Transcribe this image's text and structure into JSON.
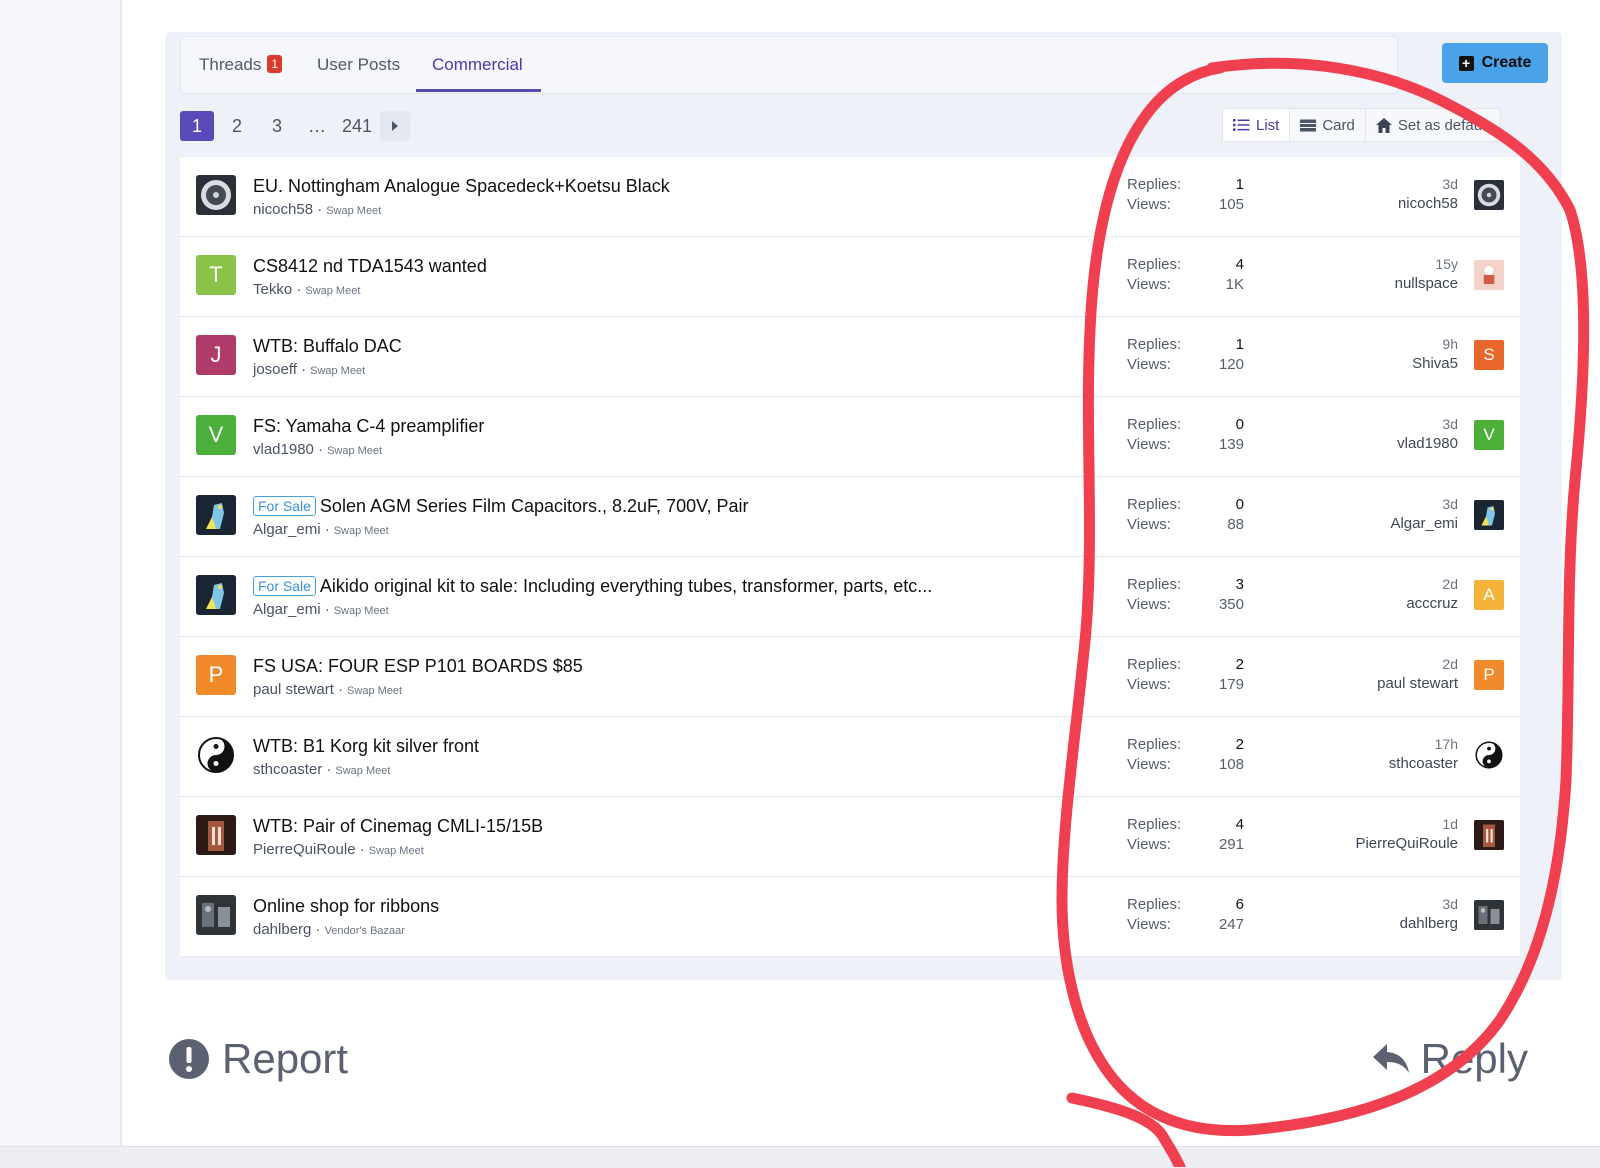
{
  "tabs": [
    {
      "label": "Threads",
      "badge": "1"
    },
    {
      "label": "User Posts"
    },
    {
      "label": "Commercial"
    }
  ],
  "create_label": "Create",
  "pagination": {
    "pages": [
      "1",
      "2",
      "3",
      "…",
      "241"
    ],
    "current": "1"
  },
  "view_switch": {
    "list": "List",
    "card": "Card",
    "default": "Set as default"
  },
  "stat_labels": {
    "replies": "Replies:",
    "views": "Views:"
  },
  "threads": [
    {
      "avatar": {
        "type": "image",
        "name": "turntable-photo",
        "color": "#2b3038"
      },
      "tag": "",
      "title": "EU. Nottingham Analogue Spacedeck+Koetsu Black",
      "author": "nicoch58",
      "forum": "Swap Meet",
      "replies": "1",
      "views": "105",
      "last_time": "3d",
      "last_user": "nicoch58",
      "last_avatar": {
        "type": "image",
        "name": "turntable-photo",
        "color": "#2b3038"
      }
    },
    {
      "avatar": {
        "type": "letter",
        "letter": "T",
        "color": "#8bc34a"
      },
      "tag": "",
      "title": "CS8412 nd TDA1543 wanted",
      "author": "Tekko",
      "forum": "Swap Meet",
      "replies": "4",
      "views": "1K",
      "last_time": "15y",
      "last_user": "nullspace",
      "last_avatar": {
        "type": "image",
        "name": "cartoon-photo",
        "color": "#e7a89a"
      }
    },
    {
      "avatar": {
        "type": "letter",
        "letter": "J",
        "color": "#b03a6a"
      },
      "tag": "",
      "title": "WTB: Buffalo DAC",
      "author": "josoeff",
      "forum": "Swap Meet",
      "replies": "1",
      "views": "120",
      "last_time": "9h",
      "last_user": "Shiva5",
      "last_avatar": {
        "type": "letter",
        "letter": "S",
        "color": "#e9672a"
      }
    },
    {
      "avatar": {
        "type": "letter",
        "letter": "V",
        "color": "#4caf3a"
      },
      "tag": "",
      "title": "FS: Yamaha C-4 preamplifier",
      "author": "vlad1980",
      "forum": "Swap Meet",
      "replies": "0",
      "views": "139",
      "last_time": "3d",
      "last_user": "vlad1980",
      "last_avatar": {
        "type": "letter",
        "letter": "V",
        "color": "#4caf3a"
      }
    },
    {
      "avatar": {
        "type": "image",
        "name": "parrot-photo",
        "color": "#3f6f8f"
      },
      "tag": "For Sale",
      "title": "Solen AGM Series Film Capacitors., 8.2uF, 700V, Pair",
      "author": "Algar_emi",
      "forum": "Swap Meet",
      "replies": "0",
      "views": "88",
      "last_time": "3d",
      "last_user": "Algar_emi",
      "last_avatar": {
        "type": "image",
        "name": "parrot-photo",
        "color": "#3f6f8f"
      }
    },
    {
      "avatar": {
        "type": "image",
        "name": "parrot-photo",
        "color": "#3f6f8f"
      },
      "tag": "For Sale",
      "title": "Aikido original kit to sale: Including everything tubes, transformer, parts, etc...",
      "author": "Algar_emi",
      "forum": "Swap Meet",
      "replies": "3",
      "views": "350",
      "last_time": "2d",
      "last_user": "acccruz",
      "last_avatar": {
        "type": "letter",
        "letter": "A",
        "color": "#f4b43a"
      }
    },
    {
      "avatar": {
        "type": "letter",
        "letter": "P",
        "color": "#f08a2a"
      },
      "tag": "",
      "title": "FS USA: FOUR ESP P101 BOARDS $85",
      "author": "paul stewart",
      "forum": "Swap Meet",
      "replies": "2",
      "views": "179",
      "last_time": "2d",
      "last_user": "paul stewart",
      "last_avatar": {
        "type": "letter",
        "letter": "P",
        "color": "#f08a2a"
      }
    },
    {
      "avatar": {
        "type": "image",
        "name": "yin-yang-logo",
        "color": "#ffffff"
      },
      "tag": "",
      "title": "WTB: B1 Korg kit silver front",
      "author": "sthcoaster",
      "forum": "Swap Meet",
      "replies": "2",
      "views": "108",
      "last_time": "17h",
      "last_user": "sthcoaster",
      "last_avatar": {
        "type": "image",
        "name": "yin-yang-logo",
        "color": "#ffffff"
      }
    },
    {
      "avatar": {
        "type": "image",
        "name": "building-photo",
        "color": "#4a2a22"
      },
      "tag": "",
      "title": "WTB: Pair of Cinemag CMLI-15/15B",
      "author": "PierreQuiRoule",
      "forum": "Swap Meet",
      "replies": "4",
      "views": "291",
      "last_time": "1d",
      "last_user": "PierreQuiRoule",
      "last_avatar": {
        "type": "image",
        "name": "building-photo",
        "color": "#4a2a22"
      }
    },
    {
      "avatar": {
        "type": "image",
        "name": "equipment-photo",
        "color": "#3d4148"
      },
      "tag": "",
      "title": "Online shop for ribbons",
      "author": "dahlberg",
      "forum": "Vendor's Bazaar",
      "replies": "6",
      "views": "247",
      "last_time": "3d",
      "last_user": "dahlberg",
      "last_avatar": {
        "type": "image",
        "name": "equipment-photo",
        "color": "#3d4148"
      }
    }
  ],
  "footer": {
    "report_label": "Report",
    "reply_label": "Reply"
  },
  "colors": {
    "accent": "#5a49b8",
    "create_button": "#4aa3e8",
    "badge": "#d93a2b",
    "annotation": "#f0404f"
  }
}
